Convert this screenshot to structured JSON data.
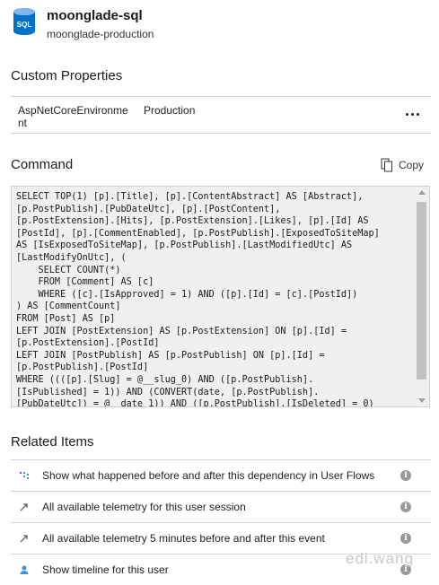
{
  "header": {
    "title": "moonglade-sql",
    "subtitle": "moonglade-production",
    "icon_label": "SQL",
    "icon_color": "#0072c6"
  },
  "custom_properties": {
    "title": "Custom Properties",
    "key": "AspNetCoreEnvironment",
    "value": "Production",
    "more_icon": "ellipsis-icon"
  },
  "command": {
    "title": "Command",
    "copy_label": "Copy",
    "copy_icon": "copy-icon",
    "sql": "SELECT TOP(1) [p].[Title], [p].[ContentAbstract] AS [Abstract],\n[p.PostPublish].[PubDateUtc], [p].[PostContent],\n[p.PostExtension].[Hits], [p.PostExtension].[Likes], [p].[Id] AS\n[PostId], [p].[CommentEnabled], [p.PostPublish].[ExposedToSiteMap]\nAS [IsExposedToSiteMap], [p.PostPublish].[LastModifiedUtc] AS\n[LastModifyOnUtc], (\n    SELECT COUNT(*)\n    FROM [Comment] AS [c]\n    WHERE ([c].[IsApproved] = 1) AND ([p].[Id] = [c].[PostId])\n) AS [CommentCount]\nFROM [Post] AS [p]\nLEFT JOIN [PostExtension] AS [p.PostExtension] ON [p].[Id] =\n[p.PostExtension].[PostId]\nLEFT JOIN [PostPublish] AS [p.PostPublish] ON [p].[Id] =\n[p.PostPublish].[PostId]\nWHERE ((([p].[Slug] = @__slug_0) AND ([p.PostPublish].\n[IsPublished] = 1)) AND (CONVERT(date, [p.PostPublish].\n[PubDateUtc]) = @__date_1)) AND ([p.PostPublish].[IsDeleted] = 0)"
  },
  "related_items": {
    "title": "Related Items",
    "items": [
      {
        "icon": "user-flows-icon",
        "label": "Show what happened before and after this dependency in User Flows"
      },
      {
        "icon": "arrow-up-right-icon",
        "label": "All available telemetry for this user session"
      },
      {
        "icon": "arrow-up-right-icon",
        "label": "All available telemetry 5 minutes before and after this event"
      },
      {
        "icon": "user-icon",
        "label": "Show timeline for this user"
      }
    ],
    "info_glyph": "i"
  },
  "watermark": "edi.wang"
}
